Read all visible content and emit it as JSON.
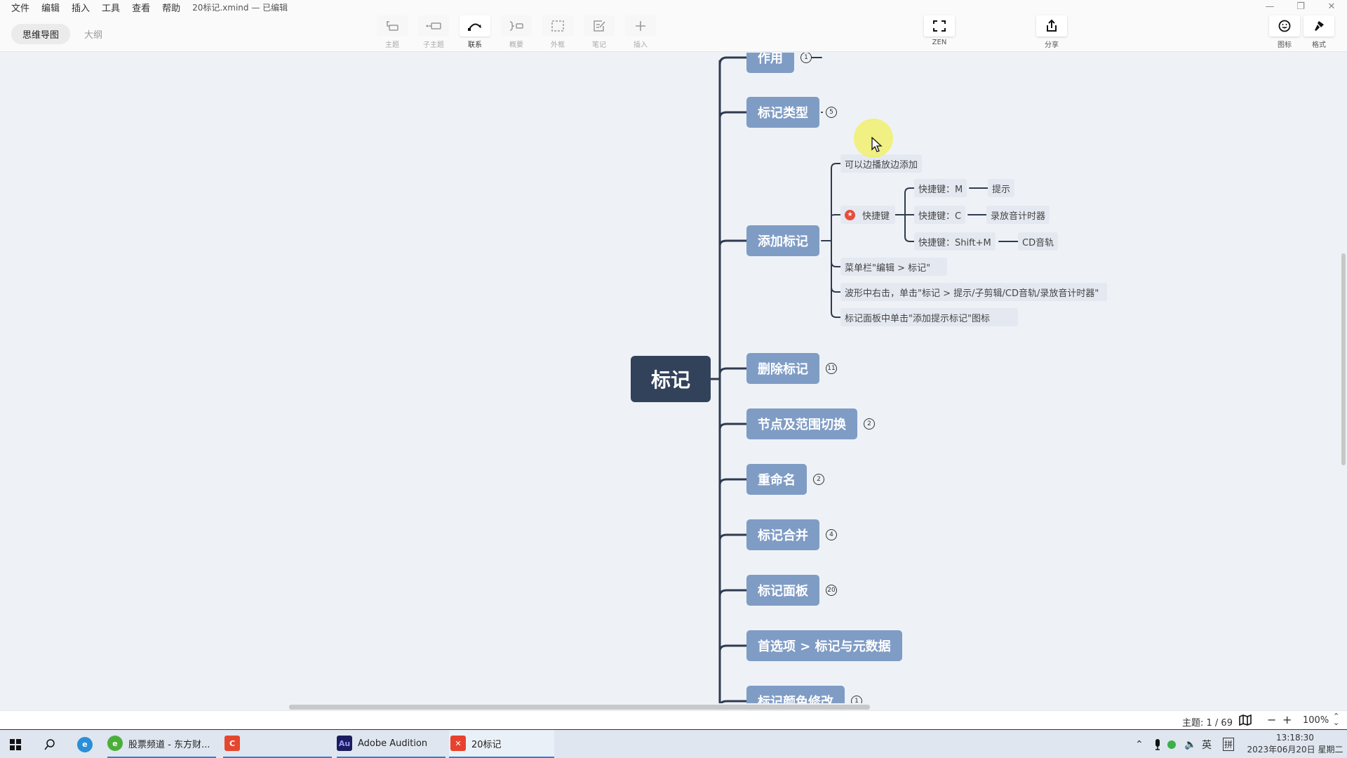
{
  "menubar": {
    "items": [
      "文件",
      "编辑",
      "插入",
      "工具",
      "查看",
      "帮助"
    ],
    "file_title": "20标记.xmind — 已编辑"
  },
  "window_controls": {
    "minimize": "—",
    "restore": "❐",
    "close": "✕"
  },
  "view_tabs": [
    {
      "label": "思维导图",
      "active": true
    },
    {
      "label": "大纲",
      "active": false
    }
  ],
  "toolbar": {
    "tools": [
      {
        "id": "topic",
        "label": "主题",
        "icon": "topic-icon"
      },
      {
        "id": "subtopic",
        "label": "子主题",
        "icon": "subtopic-icon"
      },
      {
        "id": "relationship",
        "label": "联系",
        "icon": "relationship-icon"
      },
      {
        "id": "summary",
        "label": "概要",
        "icon": "summary-icon"
      },
      {
        "id": "boundary",
        "label": "外框",
        "icon": "boundary-icon"
      },
      {
        "id": "note",
        "label": "笔记",
        "icon": "note-icon"
      },
      {
        "id": "insert",
        "label": "插入",
        "icon": "plus-icon"
      }
    ],
    "zen_label": "ZEN",
    "share_label": "分享",
    "icon_label": "图标",
    "format_label": "格式"
  },
  "mindmap": {
    "root": "标记",
    "branches": [
      {
        "label": "作用",
        "count": "1"
      },
      {
        "label": "标记类型",
        "count": "5"
      },
      {
        "label": "添加标记",
        "count": null,
        "children": [
          {
            "label": "可以边播放边添加"
          },
          {
            "label": "快捷键",
            "marker": "star",
            "children": [
              {
                "label": "快捷键：M",
                "result": "提示"
              },
              {
                "label": "快捷键：C",
                "result": "录放音计时器"
              },
              {
                "label": "快捷键：Shift+M",
                "result": "CD音轨"
              }
            ]
          },
          {
            "label": "菜单栏\"编辑 > 标记\""
          },
          {
            "label": "波形中右击，单击\"标记 > 提示/子剪辑/CD音轨/录放音计时器\""
          },
          {
            "label": "标记面板中单击\"添加提示标记\"图标"
          }
        ]
      },
      {
        "label": "删除标记",
        "count": "11"
      },
      {
        "label": "节点及范围切换",
        "count": "2"
      },
      {
        "label": "重命名",
        "count": "2"
      },
      {
        "label": "标记合并",
        "count": "4"
      },
      {
        "label": "标记面板",
        "count": "20"
      },
      {
        "label": "首选项 > 标记与元数据",
        "count": null
      },
      {
        "label": "标记颜色修改",
        "count": "1"
      }
    ]
  },
  "statusbar": {
    "topic_count": "主题: 1 / 69",
    "zoom_out": "−",
    "zoom_in": "+",
    "zoom_level": "100%"
  },
  "taskbar": {
    "items": [
      {
        "label": "股票频道 - 东方财...",
        "icon": "browser-icon"
      },
      {
        "label": "",
        "icon": "camtasia-icon"
      },
      {
        "label": "Adobe Audition",
        "icon": "audition-icon"
      },
      {
        "label": "20标记",
        "icon": "xmind-icon"
      }
    ],
    "tray": {
      "ime_lang": "英",
      "ime_mode": "拼"
    },
    "clock": {
      "time": "13:18:30",
      "date": "2023年06月20日 星期二"
    }
  },
  "colors": {
    "root_node": "#33425b",
    "main_node": "#7f9cc5",
    "sub_node": "#e4e9f1",
    "canvas": "#eef2f7",
    "marker_red": "#e84c3d"
  }
}
